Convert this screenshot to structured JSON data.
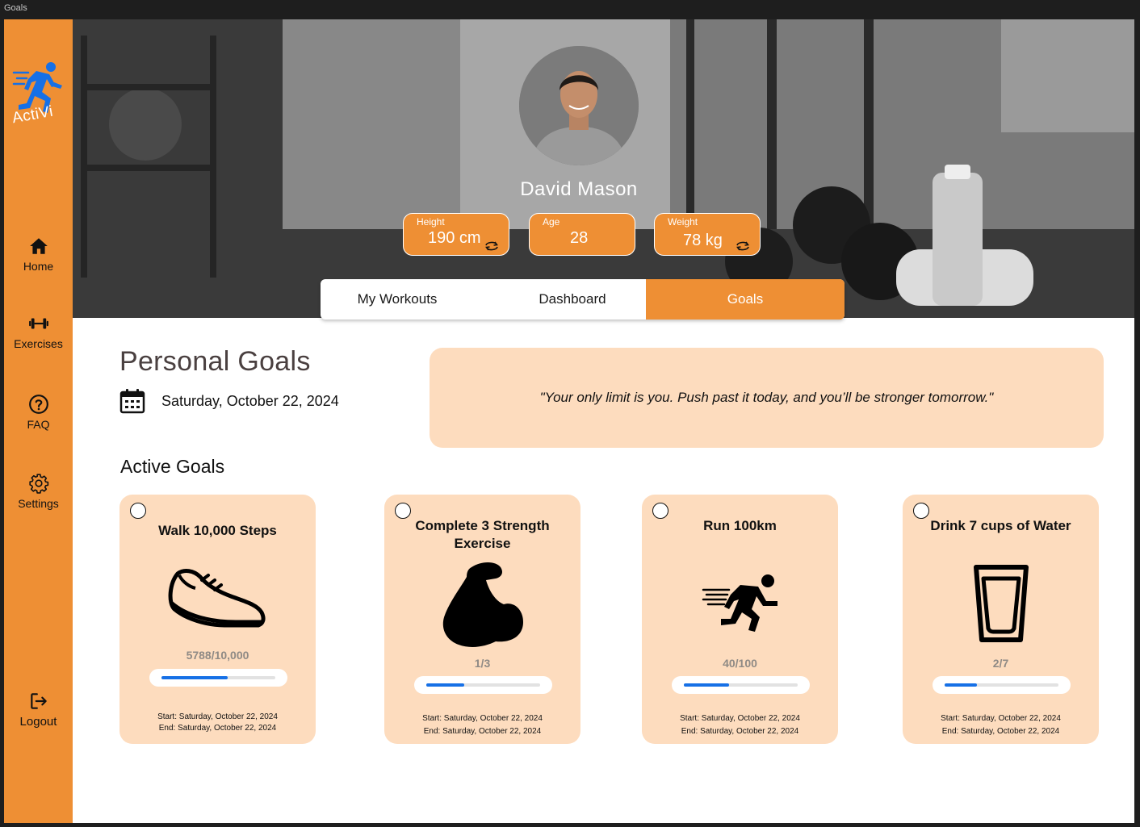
{
  "window": {
    "title": "Goals"
  },
  "brand": {
    "name": "ActiVi"
  },
  "nav": {
    "home": "Home",
    "exercises": "Exercises",
    "faq": "FAQ",
    "settings": "Settings",
    "logout": "Logout"
  },
  "profile": {
    "name": "David Mason",
    "stats": {
      "height": {
        "label": "Height",
        "value": "190 cm"
      },
      "age": {
        "label": "Age",
        "value": "28"
      },
      "weight": {
        "label": "Weight",
        "value": "78 kg"
      }
    }
  },
  "tabs": {
    "my_workouts": "My Workouts",
    "dashboard": "Dashboard",
    "goals": "Goals",
    "active": "goals"
  },
  "page": {
    "title": "Personal Goals",
    "date": "Saturday, October 22, 2024",
    "quote": "\"Your only limit is you. Push past it today, and you’ll be stronger tomorrow.\"",
    "section_title": "Active Goals"
  },
  "goals": [
    {
      "title": "Walk 10,000 Steps",
      "icon": "shoe-icon",
      "progress_text": "5788/10,000",
      "progress": 0.58,
      "start": "Start:  Saturday, October 22, 2024",
      "end": "End: Saturday, October 22, 2024"
    },
    {
      "title": "Complete 3 Strength Exercise",
      "icon": "flexed-bicep-icon",
      "progress_text": "1/3",
      "progress": 0.33,
      "start": "Start:  Saturday, October 22, 2024",
      "end": "End: Saturday, October 22, 2024"
    },
    {
      "title": "Run 100km",
      "icon": "running-person-icon",
      "progress_text": "40/100",
      "progress": 0.4,
      "start": "Start:  Saturday, October 22, 2024",
      "end": "End: Saturday, October 22, 2024"
    },
    {
      "title": "Drink 7 cups of Water",
      "icon": "water-glass-icon",
      "progress_text": "2/7",
      "progress": 0.2857,
      "start": "Start:  Saturday, October 22, 2024",
      "end": "End: Saturday, October 22, 2024"
    }
  ],
  "colors": {
    "accent": "#ee8f34",
    "card_bg": "#fddcbe",
    "progress": "#1670e6"
  }
}
